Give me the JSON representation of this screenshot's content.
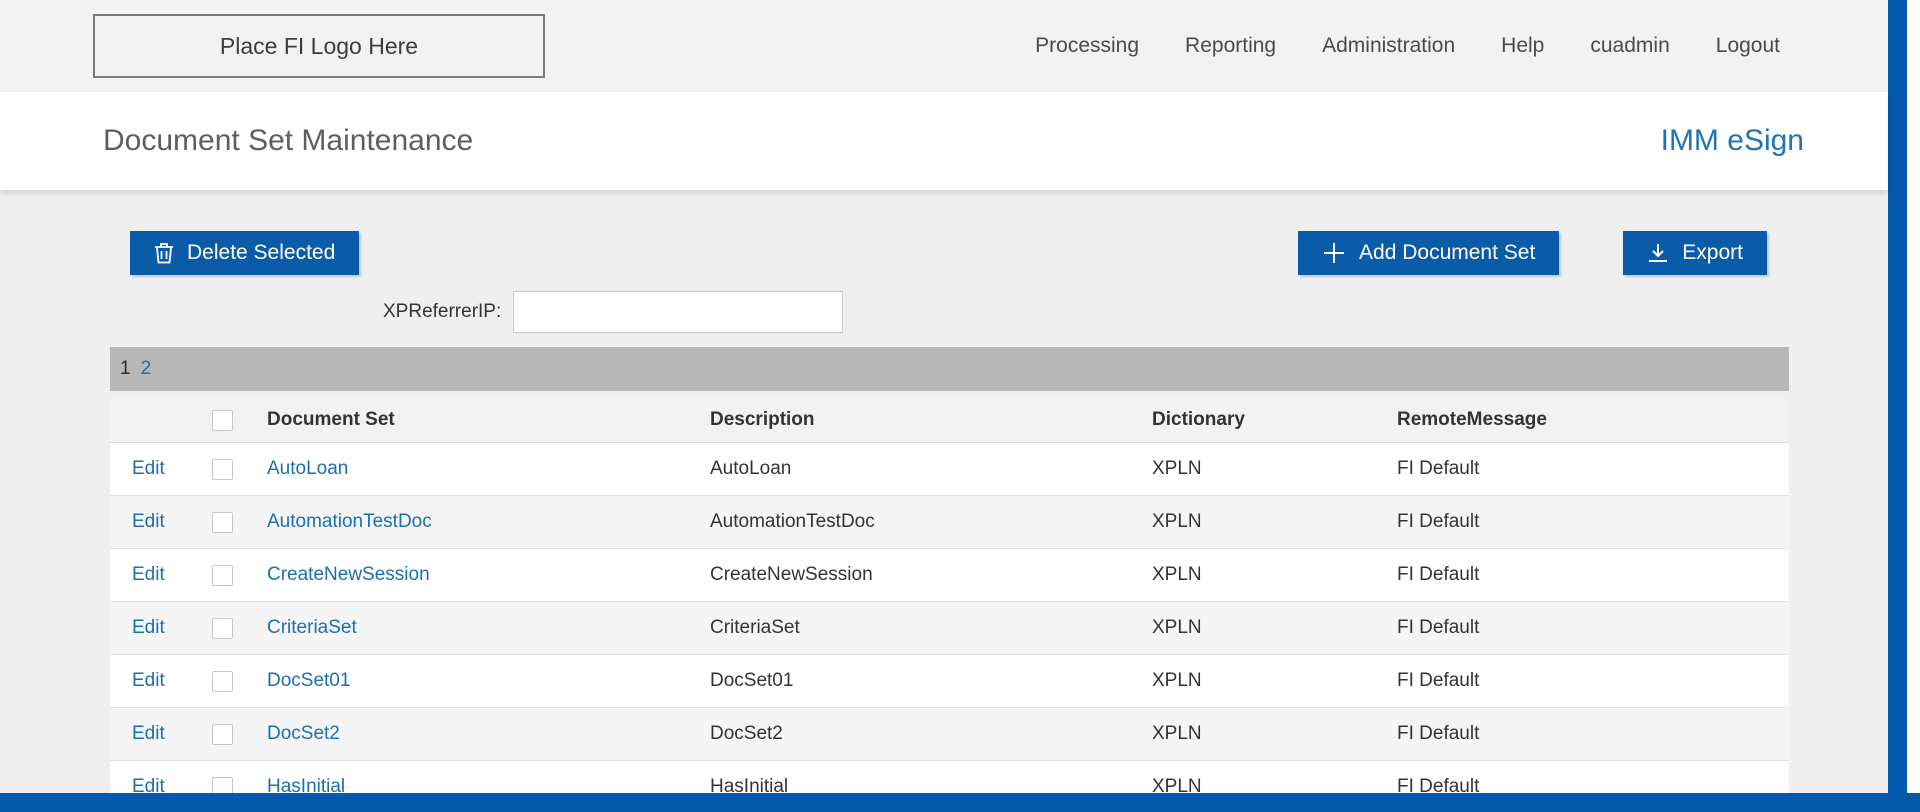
{
  "header": {
    "logo_text": "Place FI Logo Here",
    "nav": [
      {
        "label": "Processing"
      },
      {
        "label": "Reporting"
      },
      {
        "label": "Administration"
      },
      {
        "label": "Help"
      },
      {
        "label": "cuadmin"
      },
      {
        "label": "Logout"
      }
    ]
  },
  "title_bar": {
    "title": "Document Set Maintenance",
    "brand": "IMM eSign"
  },
  "toolbar": {
    "delete_label": "Delete Selected",
    "add_label": "Add Document Set",
    "export_label": "Export"
  },
  "filter": {
    "label": "XPReferrerIP:",
    "value": ""
  },
  "pagination": {
    "pages": [
      "1",
      "2"
    ],
    "current": "1"
  },
  "table": {
    "edit_label": "Edit",
    "columns": {
      "document_set": "Document Set",
      "description": "Description",
      "dictionary": "Dictionary",
      "remote_message": "RemoteMessage"
    },
    "rows": [
      {
        "document_set": "AutoLoan",
        "description": "AutoLoan",
        "dictionary": "XPLN",
        "remote_message": "FI Default"
      },
      {
        "document_set": "AutomationTestDoc",
        "description": "AutomationTestDoc",
        "dictionary": "XPLN",
        "remote_message": "FI Default"
      },
      {
        "document_set": "CreateNewSession",
        "description": "CreateNewSession",
        "dictionary": "XPLN",
        "remote_message": "FI Default"
      },
      {
        "document_set": "CriteriaSet",
        "description": "CriteriaSet",
        "dictionary": "XPLN",
        "remote_message": "FI Default"
      },
      {
        "document_set": "DocSet01",
        "description": "DocSet01",
        "dictionary": "XPLN",
        "remote_message": "FI Default"
      },
      {
        "document_set": "DocSet2",
        "description": "DocSet2",
        "dictionary": "XPLN",
        "remote_message": "FI Default"
      },
      {
        "document_set": "HasInitial",
        "description": "HasInitial",
        "dictionary": "XPLN",
        "remote_message": "FI Default"
      }
    ]
  },
  "colors": {
    "accent_blue": "#0459ad",
    "button_blue": "#0b5ca8",
    "link_blue": "#1c6fad",
    "header_gray": "#f2f2f2",
    "pager_gray": "#b7b7b7"
  }
}
